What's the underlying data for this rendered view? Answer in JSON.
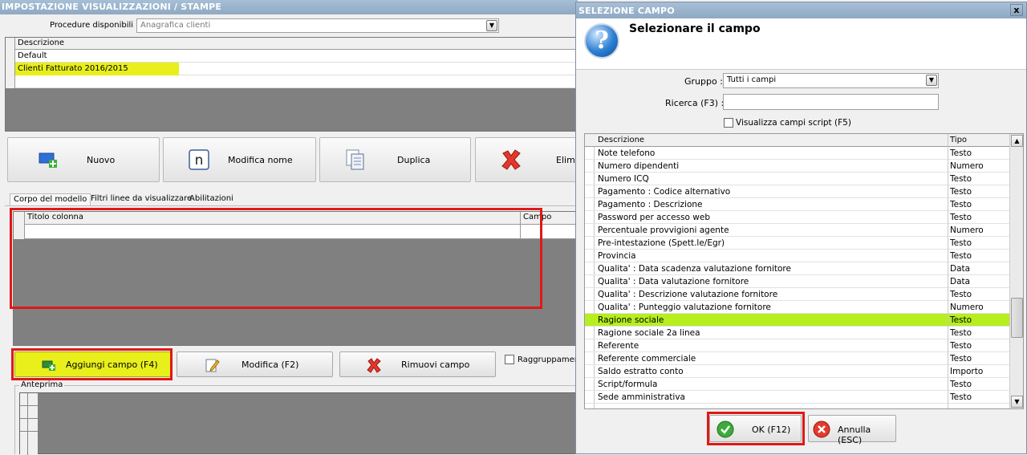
{
  "main": {
    "title": "IMPOSTAZIONE VISUALIZZAZIONI / STAMPE",
    "procedure_label": "Procedure disponibili :",
    "procedure_value": "Anagrafica clienti",
    "models_grid": {
      "header": "Descrizione",
      "rows": [
        "Default",
        "Clienti Fatturato 2016/2015"
      ]
    },
    "buttons": {
      "nuovo": "Nuovo",
      "modifica_nome": "Modifica nome",
      "duplica": "Duplica",
      "elimina": "Elimin"
    },
    "tabs": [
      "Corpo del modello",
      "Filtri linee da visualizzare",
      "Abilitazioni"
    ],
    "columns_grid": {
      "headers": [
        "Titolo colonna",
        "Campo"
      ]
    },
    "field_buttons": {
      "aggiungi": "Aggiungi campo (F4)",
      "modifica": "Modifica (F2)",
      "rimuovi": "Rimuovi campo"
    },
    "grouping_label": "Raggruppament",
    "preview_label": "Anteprima"
  },
  "dialog": {
    "title": "SELEZIONE CAMPO",
    "close_label": "x",
    "heading": "Selezionare il campo",
    "gruppo_label": "Gruppo :",
    "gruppo_value": "Tutti i campi",
    "ricerca_label": "Ricerca (F3) :",
    "ricerca_value": "",
    "script_checkbox_label": "Visualizza campi script (F5)",
    "list_headers": [
      "Descrizione",
      "Tipo"
    ],
    "rows": [
      {
        "desc": "Note telefono",
        "tipo": "Testo"
      },
      {
        "desc": "Numero dipendenti",
        "tipo": "Numero"
      },
      {
        "desc": "Numero ICQ",
        "tipo": "Testo"
      },
      {
        "desc": "Pagamento : Codice alternativo",
        "tipo": "Testo"
      },
      {
        "desc": "Pagamento : Descrizione",
        "tipo": "Testo"
      },
      {
        "desc": "Password per accesso web",
        "tipo": "Testo"
      },
      {
        "desc": "Percentuale provvigioni agente",
        "tipo": "Numero"
      },
      {
        "desc": "Pre-intestazione (Spett.le/Egr)",
        "tipo": "Testo"
      },
      {
        "desc": "Provincia",
        "tipo": "Testo"
      },
      {
        "desc": "Qualita' : Data scadenza valutazione fornitore",
        "tipo": "Data"
      },
      {
        "desc": "Qualita' : Data valutazione fornitore",
        "tipo": "Data"
      },
      {
        "desc": "Qualita' : Descrizione valutazione fornitore",
        "tipo": "Testo"
      },
      {
        "desc": "Qualita' : Punteggio valutazione fornitore",
        "tipo": "Numero"
      },
      {
        "desc": "Ragione sociale",
        "tipo": "Testo",
        "selected": true
      },
      {
        "desc": "Ragione sociale 2a linea",
        "tipo": "Testo"
      },
      {
        "desc": "Referente",
        "tipo": "Testo"
      },
      {
        "desc": "Referente commerciale",
        "tipo": "Testo"
      },
      {
        "desc": "Saldo estratto conto",
        "tipo": "Importo"
      },
      {
        "desc": "Script/formula",
        "tipo": "Testo"
      },
      {
        "desc": "Sede amministrativa",
        "tipo": "Testo"
      }
    ],
    "ok_label": "OK (F12)",
    "cancel_label": "Annulla (ESC)"
  },
  "colors": {
    "highlight_yellow": "#e8ef1a",
    "selected_row": "#b6ee1f",
    "annotation_red": "#e01818",
    "titlebar": "#9ab3cc"
  }
}
